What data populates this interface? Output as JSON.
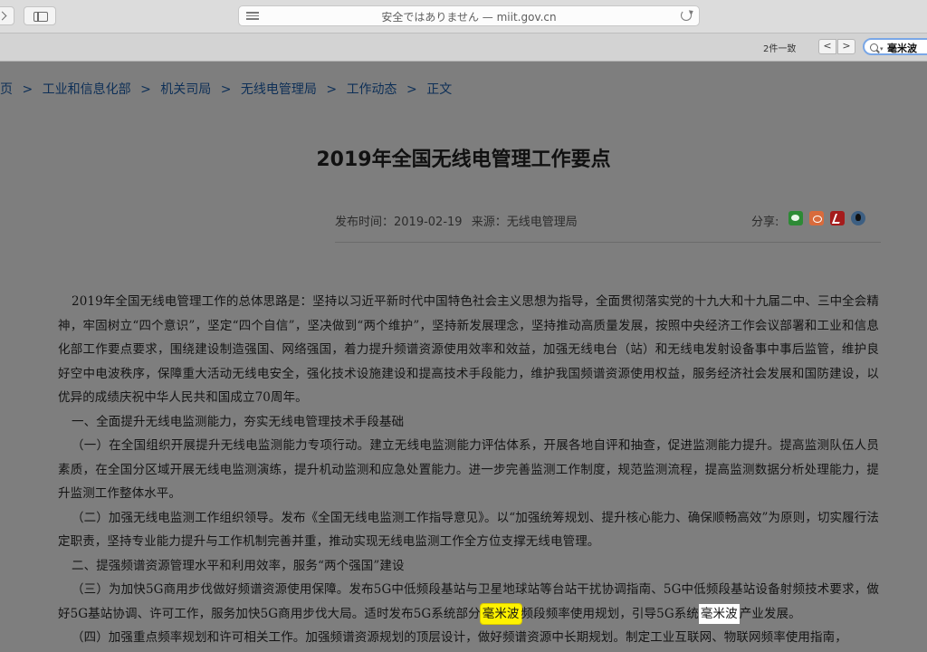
{
  "browser": {
    "url_text": "安全ではありません — miit.gov.cn",
    "find_count": "2件一致",
    "find_prev": "<",
    "find_next": ">",
    "find_query": "毫米波"
  },
  "breadcrumb": {
    "items": [
      "页",
      "工业和信息化部",
      "机关司局",
      "无线电管理局",
      "工作动态",
      "正文"
    ],
    "separator": ">"
  },
  "article": {
    "title": "2019年全国无线电管理工作要点",
    "publish_time": "发布时间：2019-02-19",
    "source": "来源：无线电管理局",
    "share_label": "分享:",
    "share_icons": [
      "wechat-icon",
      "weibo-icon",
      "pdf-icon",
      "qq-icon"
    ],
    "p1": "2019年全国无线电管理工作的总体思路是：坚持以习近平新时代中国特色社会主义思想为指导，全面贯彻落实党的十九大和十九届二中、三中全会精神，牢固树立“四个意识”，坚定“四个自信”，坚决做到“两个维护”，坚持新发展理念，坚持推动高质量发展，按照中央经济工作会议部署和工业和信息化部工作要点要求，围绕建设制造强国、网络强国，着力提升频谱资源使用效率和效益，加强无线电台（站）和无线电发射设备事中事后监管，维护良好空中电波秩序，保障重大活动无线电安全，强化技术设施建设和提高技术手段能力，维护我国频谱资源使用权益，服务经济社会发展和国防建设，以优异的成绩庆祝中华人民共和国成立70周年。",
    "h1": "一、全面提升无线电监测能力，夯实无线电管理技术手段基础",
    "p2": "（一）在全国组织开展提升无线电监测能力专项行动。建立无线电监测能力评估体系，开展各地自评和抽查，促进监测能力提升。提高监测队伍人员素质，在全国分区域开展无线电监测演练，提升机动监测和应急处置能力。进一步完善监测工作制度，规范监测流程，提高监测数据分析处理能力，提升监测工作整体水平。",
    "p3": "（二）加强无线电监测工作组织领导。发布《全国无线电监测工作指导意见》。以“加强统筹规划、提升核心能力、确保顺畅高效”为原则，切实履行法定职责，坚持专业能力提升与工作机制完善并重，推动实现无线电监测工作全方位支撑无线电管理。",
    "h2": "二、提强频谱资源管理水平和利用效率，服务“两个强国”建设",
    "p4_a": "（三）为加快5G商用步伐做好频谱资源使用保障。发布5G中低频段基站与卫星地球站等台站干扰协调指南、5G中低频段基站设备射频技术要求，做好5G基站协调、许可工作，服务加快5G商用步伐大局。适时发布5G系统部分",
    "p4_hl1": "毫米波",
    "p4_b": "频段频率使用规划，引导5G系统",
    "p4_hl2": "毫米波",
    "p4_c": "产业发展。",
    "p5": "（四）加强重点频率规划和许可相关工作。加强频谱资源规划的顶层设计，做好频谱资源中长期规划。制定工业互联网、物联网频率使用指南，"
  }
}
